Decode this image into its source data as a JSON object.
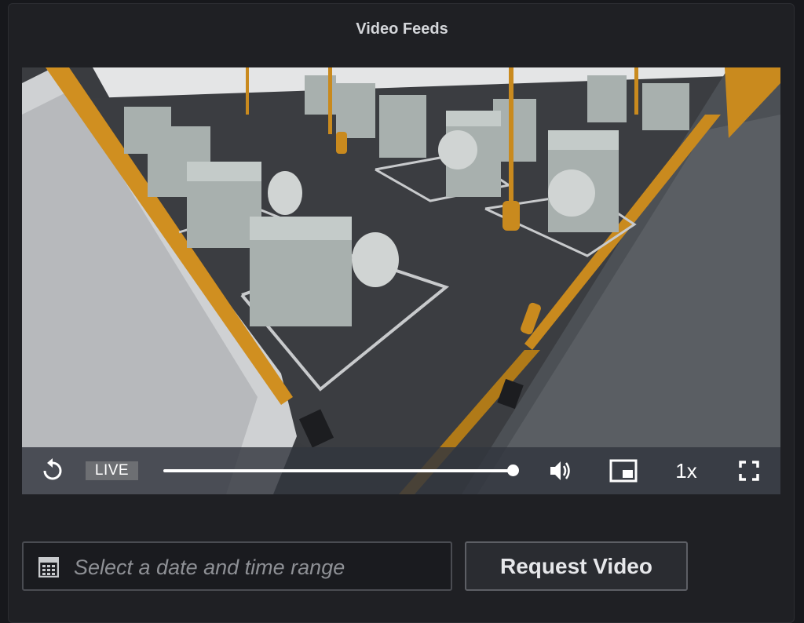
{
  "panel": {
    "title": "Video Feeds"
  },
  "player": {
    "live_label": "LIVE",
    "speed_label": "1x",
    "progress": 1.0,
    "icons": [
      "replay-icon",
      "volume-icon",
      "picture-in-picture-icon",
      "fullscreen-icon"
    ]
  },
  "request": {
    "date_placeholder": "Select a date and time range",
    "button_label": "Request Video",
    "calendar_icon": "calendar-icon"
  }
}
